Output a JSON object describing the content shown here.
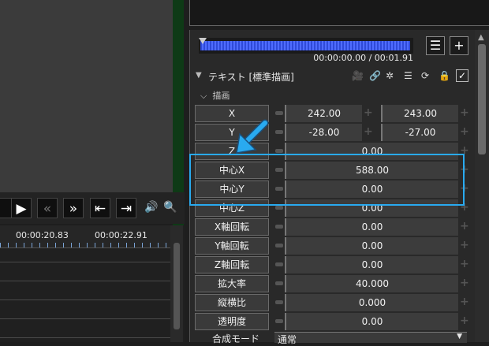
{
  "playback": {
    "buttons": [
      {
        "name": "play-selection-button",
        "glyph": "▶"
      },
      {
        "name": "prev-keyframe-button",
        "glyph": "«"
      },
      {
        "name": "next-keyframe-button",
        "glyph": "»"
      },
      {
        "name": "go-start-button",
        "glyph": "⇤"
      },
      {
        "name": "go-end-button",
        "glyph": "⇥"
      }
    ],
    "volume_glyph": "🔊",
    "zoom_glyph": "🔍"
  },
  "timeline": {
    "labels": [
      "00:00:20.83",
      "00:00:22.91"
    ]
  },
  "panel": {
    "timecode": "00:00:00.00 / 00:01.91",
    "list_glyph": "☰",
    "plus_glyph": "+",
    "header_title": "テキスト [標準描画]",
    "header_icons": [
      "🎥",
      "🔗",
      "✲",
      "☰",
      "⟳",
      "🔒"
    ],
    "check_glyph": "✓",
    "section": "描画",
    "rows": [
      {
        "label": "X",
        "v1": "242.00",
        "v2": "243.00"
      },
      {
        "label": "Y",
        "v1": "-28.00",
        "v2": "-27.00"
      },
      {
        "label": "Z",
        "value": "0.00"
      },
      {
        "label": "中心X",
        "value": "588.00"
      },
      {
        "label": "中心Y",
        "value": "0.00"
      },
      {
        "label": "中心Z",
        "value": "0.00"
      },
      {
        "label": "X軸回転",
        "value": "0.00"
      },
      {
        "label": "Y軸回転",
        "value": "0.00"
      },
      {
        "label": "Z軸回転",
        "value": "0.00"
      },
      {
        "label": "拡大率",
        "value": "40.000"
      },
      {
        "label": "縦横比",
        "value": "0.000"
      },
      {
        "label": "透明度",
        "value": "0.00"
      }
    ],
    "blend_label": "合成モード",
    "blend_value": "通常"
  },
  "colors": {
    "highlight": "#29aaf0",
    "arrow": "#29aaf0",
    "scrub": "#3d5bf0"
  }
}
